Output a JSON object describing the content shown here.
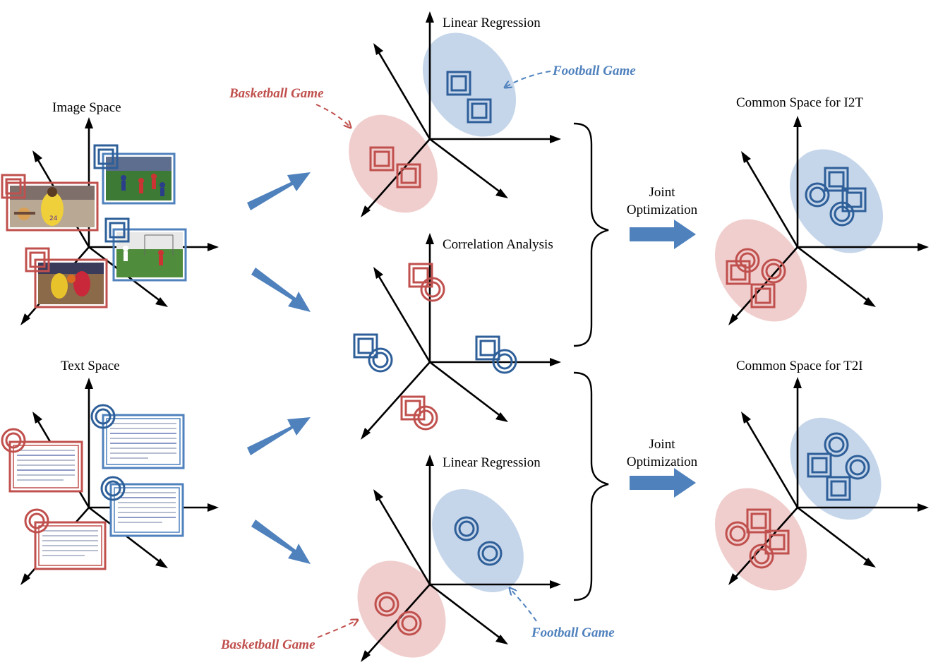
{
  "labels": {
    "image_space": "Image  Space",
    "text_space": "Text Space",
    "linear_regression_top": "Linear Regression",
    "correlation_analysis": "Correlation Analysis",
    "linear_regression_bottom": "Linear Regression",
    "basketball_top": "Basketball Game",
    "football_top": "Football Game",
    "basketball_bottom": "Basketball Game",
    "football_bottom": "Football Game",
    "joint_top_line1": "Joint",
    "joint_top_line2": "Optimization",
    "joint_bottom_line1": "Joint",
    "joint_bottom_line2": "Optimization",
    "common_i2t": "Common Space  for I2T",
    "common_t2i": "Common Space  for T2I"
  },
  "colors": {
    "basketball": "#c0504d",
    "football": "#4f81bd",
    "arrow": "#4f81bd"
  }
}
